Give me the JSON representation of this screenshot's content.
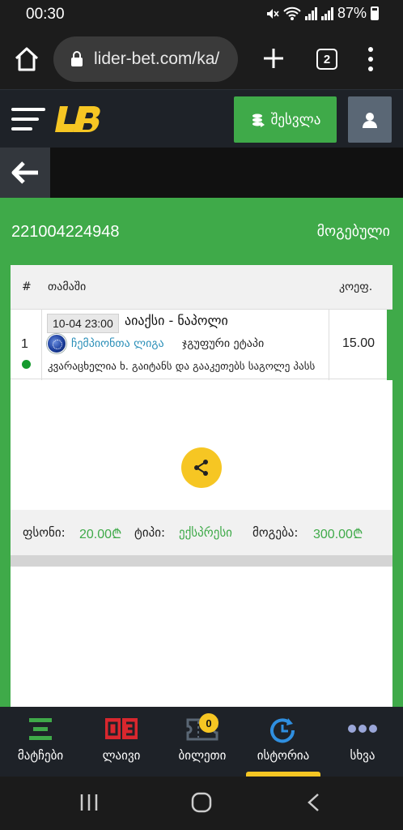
{
  "status_bar": {
    "time": "00:30",
    "battery": "87%"
  },
  "browser": {
    "url": "lider-bet.com/ka/",
    "tab_count": "2"
  },
  "header": {
    "login_label": "შესვლა"
  },
  "bet": {
    "id": "221004224948",
    "status": "მოგებული"
  },
  "table": {
    "headers": {
      "num": "#",
      "game": "თამაში",
      "odds": "კოეფ."
    },
    "rows": [
      {
        "num": "1",
        "date": "10-04 23:00",
        "match": "აიაქსი - ნაპოლი",
        "league": "ჩემპიონთა ლიგა",
        "stage": "ჯგუფური ეტაპი",
        "market": "კვარაცხელია ხ. გაიტანს და გააკეთებს საგოლე პასს",
        "odds": "15.00",
        "result": "won"
      }
    ]
  },
  "summary": {
    "stake_label": "ფსონი:",
    "stake_value": "20.00₾",
    "type_label": "ტიპი:",
    "type_value": "ექსპრესი",
    "win_label": "მოგება:",
    "win_value": "300.00₾"
  },
  "bottom_nav": {
    "items": [
      {
        "label": "მატჩები",
        "icon": "matches-icon"
      },
      {
        "label": "ლაივი",
        "icon": "live-icon"
      },
      {
        "label": "ბილეთი",
        "icon": "ticket-icon",
        "badge": "0"
      },
      {
        "label": "ისტორია",
        "icon": "history-icon",
        "active": true
      },
      {
        "label": "სხვა",
        "icon": "more-icon"
      }
    ]
  },
  "colors": {
    "green": "#3faa49",
    "yellow": "#f6c623",
    "dark": "#1e2228",
    "link_blue": "#2b8fb8"
  }
}
